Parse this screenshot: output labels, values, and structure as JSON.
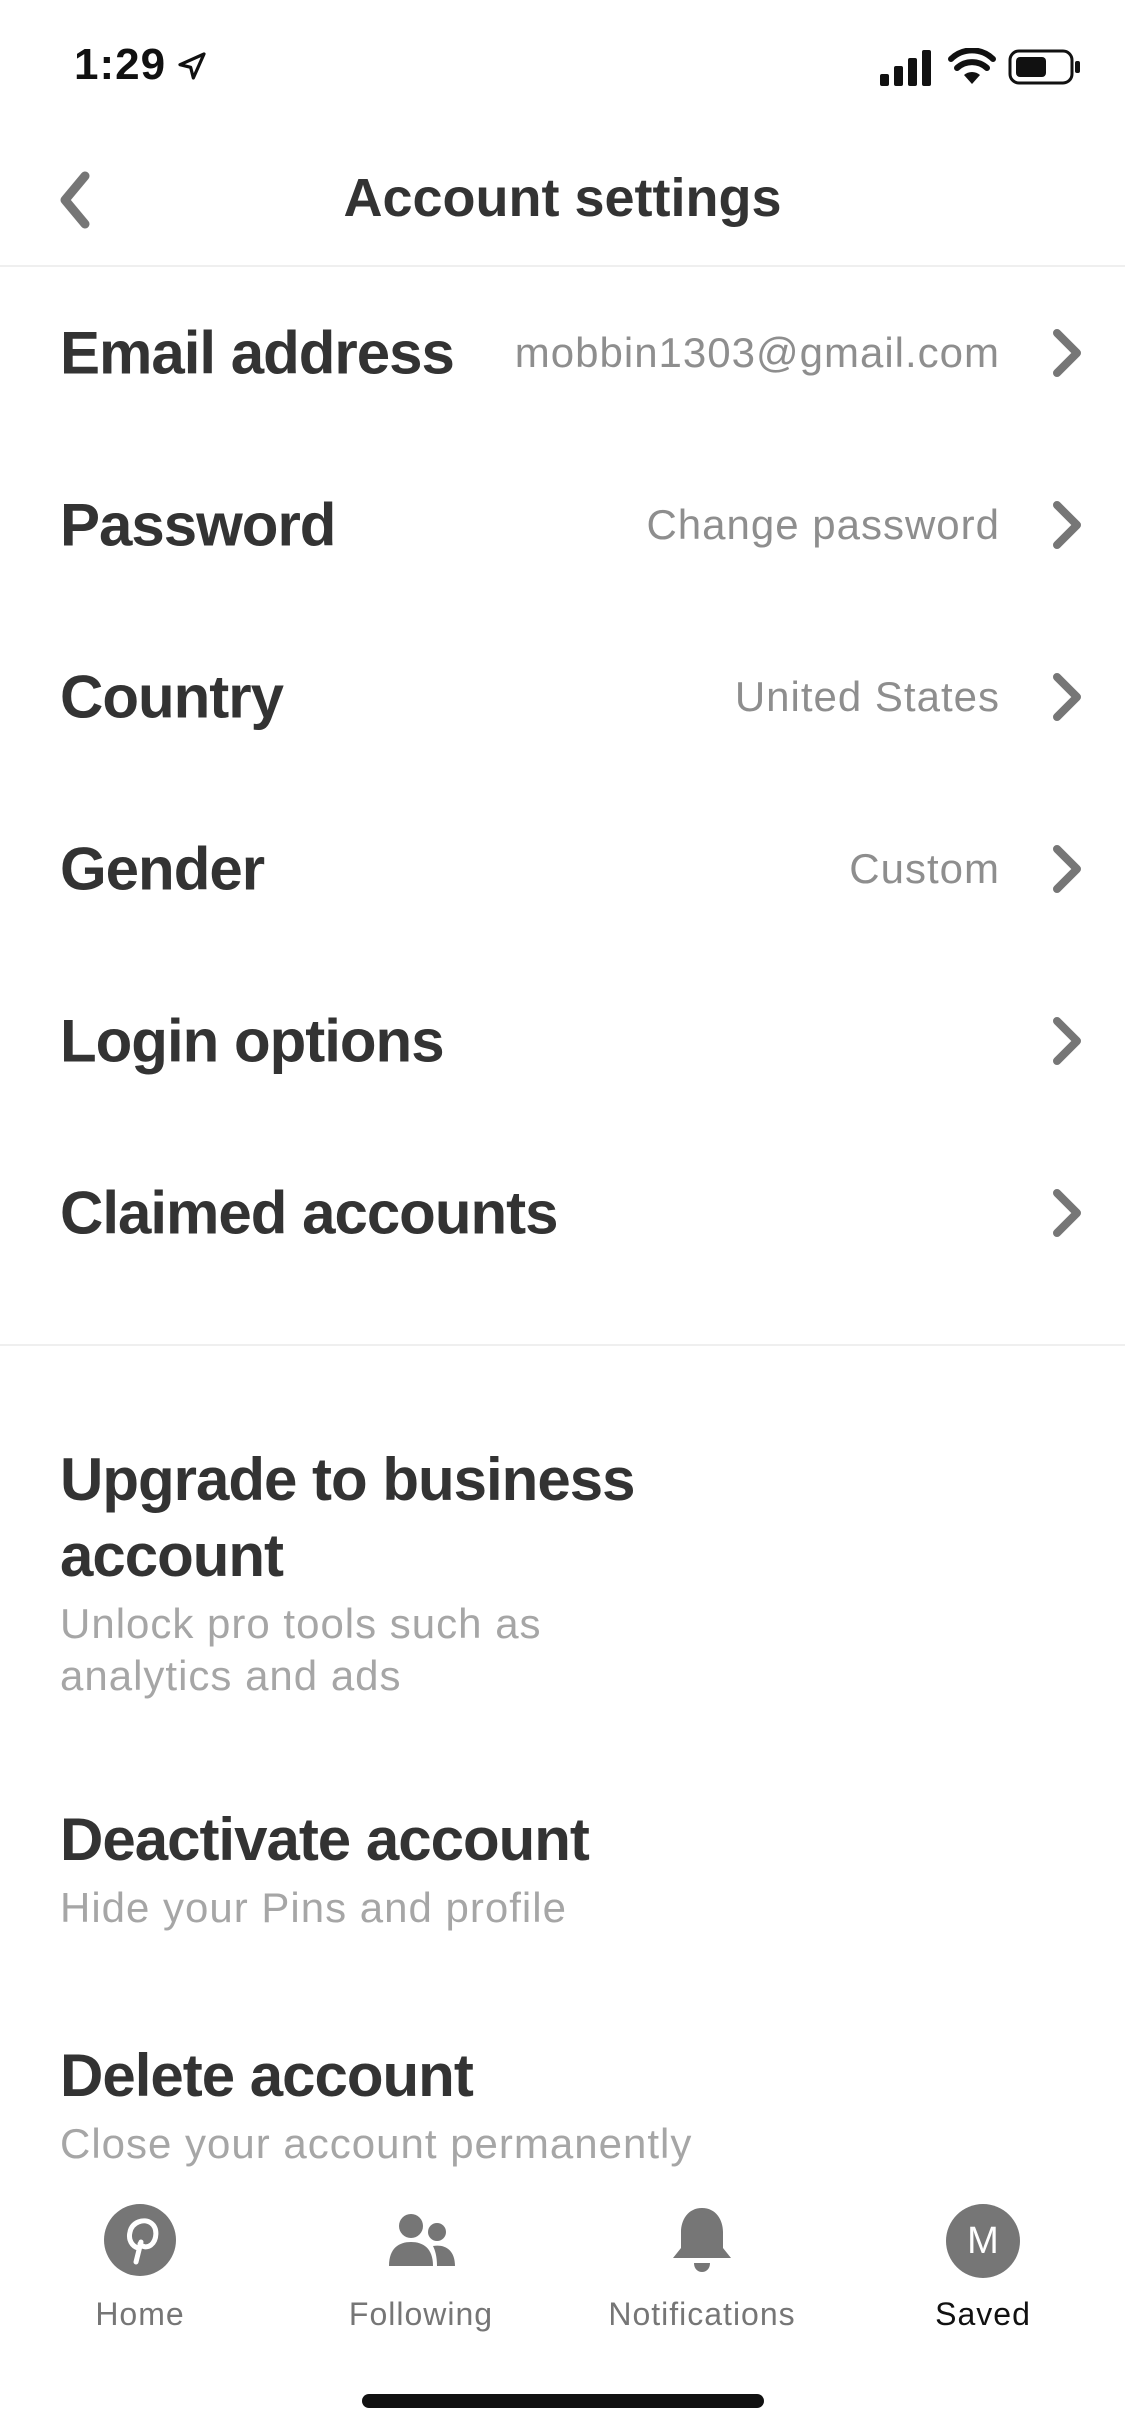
{
  "status_bar": {
    "time": "1:29",
    "icons": [
      "location-arrow-icon",
      "signal-icon",
      "wifi-icon",
      "battery-icon"
    ]
  },
  "header": {
    "title": "Account settings",
    "back_icon": "chevron-left-icon"
  },
  "settings_rows": [
    {
      "label": "Email address",
      "value": "mobbin1303@gmail.com"
    },
    {
      "label": "Password",
      "value": "Change password"
    },
    {
      "label": "Country",
      "value": "United States"
    },
    {
      "label": "Gender",
      "value": "Custom"
    },
    {
      "label": "Login options",
      "value": ""
    },
    {
      "label": "Claimed accounts",
      "value": ""
    }
  ],
  "actions": [
    {
      "title": "Upgrade to business account",
      "description": "Unlock pro tools such as analytics and ads"
    },
    {
      "title": "Deactivate account",
      "description": "Hide your Pins and profile"
    },
    {
      "title": "Delete account",
      "description": "Close your account permanently"
    }
  ],
  "tab_bar": {
    "tabs": [
      {
        "label": "Home",
        "icon": "pinterest-icon"
      },
      {
        "label": "Following",
        "icon": "people-icon"
      },
      {
        "label": "Notifications",
        "icon": "bell-icon"
      },
      {
        "label": "Saved",
        "icon": "avatar",
        "active": true
      }
    ],
    "avatar_initial": "M"
  },
  "colors": {
    "text_primary": "#333333",
    "text_secondary": "#8e8e8e",
    "text_muted": "#a6a6a6",
    "icon_gray": "#767676",
    "divider": "#efefef"
  }
}
